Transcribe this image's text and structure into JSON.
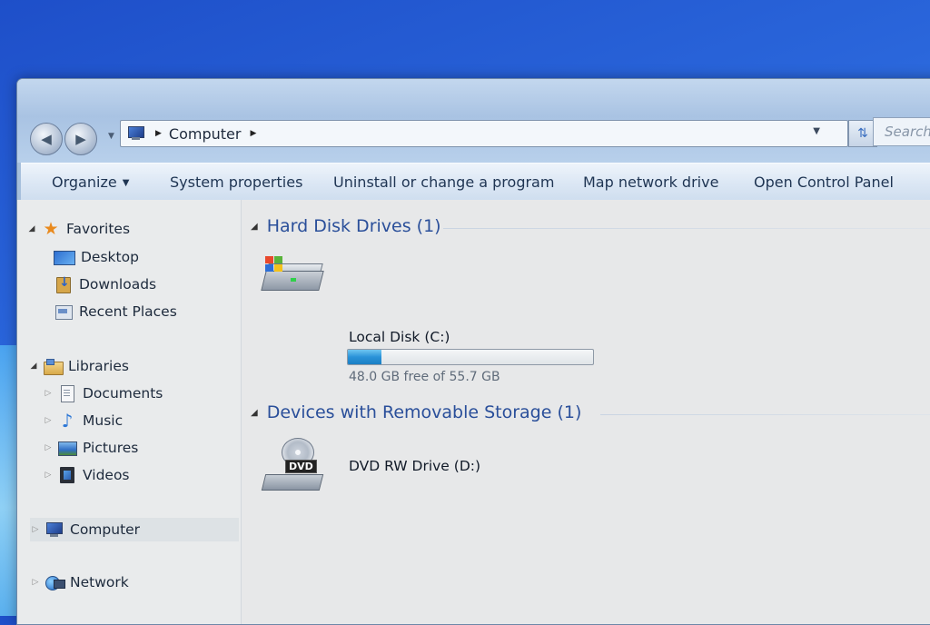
{
  "address_bar": {
    "location": "Computer",
    "search_placeholder": "Search"
  },
  "command_bar": {
    "organize": "Organize",
    "system_properties": "System properties",
    "uninstall": "Uninstall or change a program",
    "map_network_drive": "Map network drive",
    "open_control_panel": "Open Control Panel"
  },
  "nav_pane": {
    "favorites": {
      "label": "Favorites",
      "items": [
        {
          "label": "Desktop",
          "icon": "desktop-icon"
        },
        {
          "label": "Downloads",
          "icon": "downloads-folder-icon"
        },
        {
          "label": "Recent Places",
          "icon": "recent-places-icon"
        }
      ]
    },
    "libraries": {
      "label": "Libraries",
      "items": [
        {
          "label": "Documents",
          "icon": "documents-icon"
        },
        {
          "label": "Music",
          "icon": "music-icon"
        },
        {
          "label": "Pictures",
          "icon": "pictures-icon"
        },
        {
          "label": "Videos",
          "icon": "videos-icon"
        }
      ]
    },
    "computer": {
      "label": "Computer",
      "icon": "computer-icon"
    },
    "network": {
      "label": "Network",
      "icon": "network-icon"
    }
  },
  "groups": {
    "hard_disk": {
      "header": "Hard Disk Drives (1)",
      "drive": {
        "name": "Local Disk (C:)",
        "used_fraction": 0.138,
        "free_text": "48.0 GB free of 55.7 GB",
        "bar_color": "#2a92d8"
      }
    },
    "removable": {
      "header": "Devices with Removable Storage (1)",
      "drive": {
        "name": "DVD RW Drive (D:)",
        "badge": "DVD"
      }
    }
  }
}
